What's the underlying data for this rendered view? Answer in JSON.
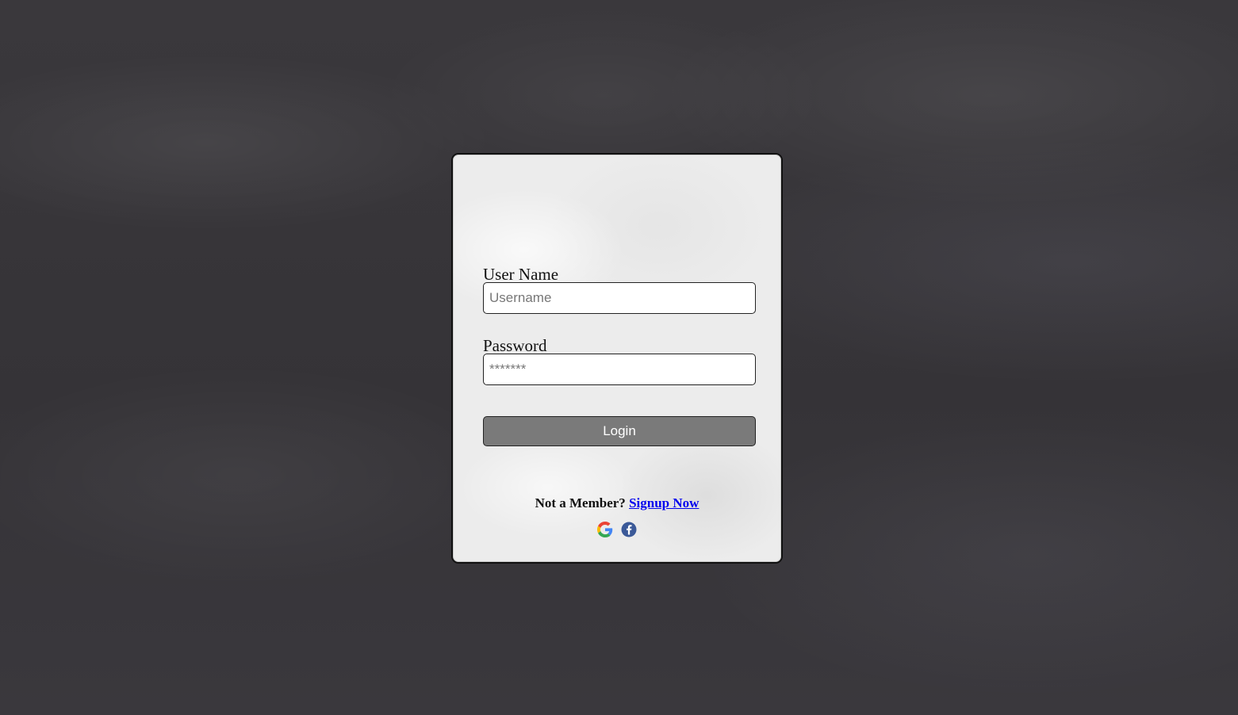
{
  "login_form": {
    "username_label": "User Name",
    "username_placeholder": "Username",
    "password_label": "Password",
    "password_placeholder": "*******",
    "login_button_label": "Login",
    "signup_prompt": "Not a Member?",
    "signup_link_label": "Signup Now",
    "social_icons": [
      "google-icon",
      "facebook-icon"
    ]
  },
  "colors": {
    "login_button_bg": "#7a7a7a",
    "signup_link": "#0000ee",
    "facebook_blue": "#3b5998"
  }
}
